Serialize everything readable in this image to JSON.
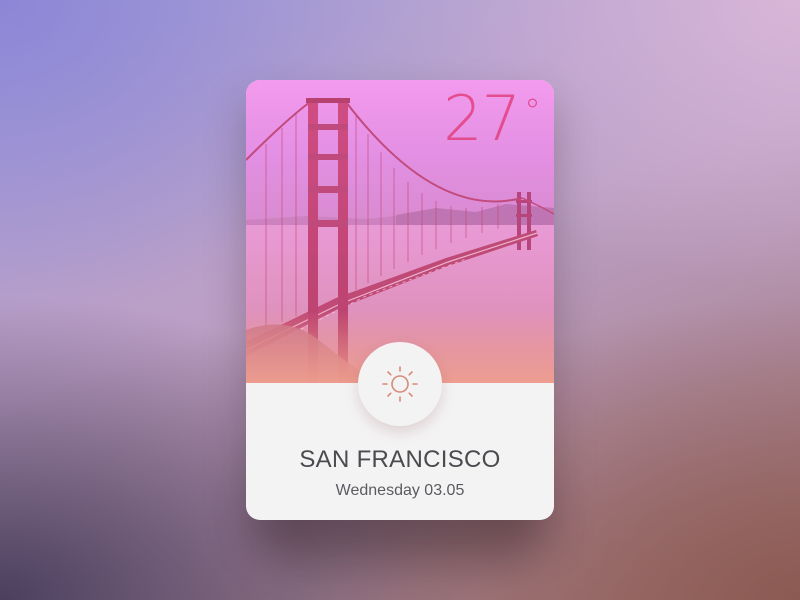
{
  "weather_card": {
    "temperature": "27",
    "degree_symbol": "°",
    "city": "SAN FRANCISCO",
    "date": "Wednesday 03.05",
    "condition_icon": "sun-icon",
    "colors": {
      "accent": "#e2417f",
      "icon": "#d98a78",
      "text": "#4a4a4f",
      "card_bottom": "#f4f3f4"
    }
  }
}
